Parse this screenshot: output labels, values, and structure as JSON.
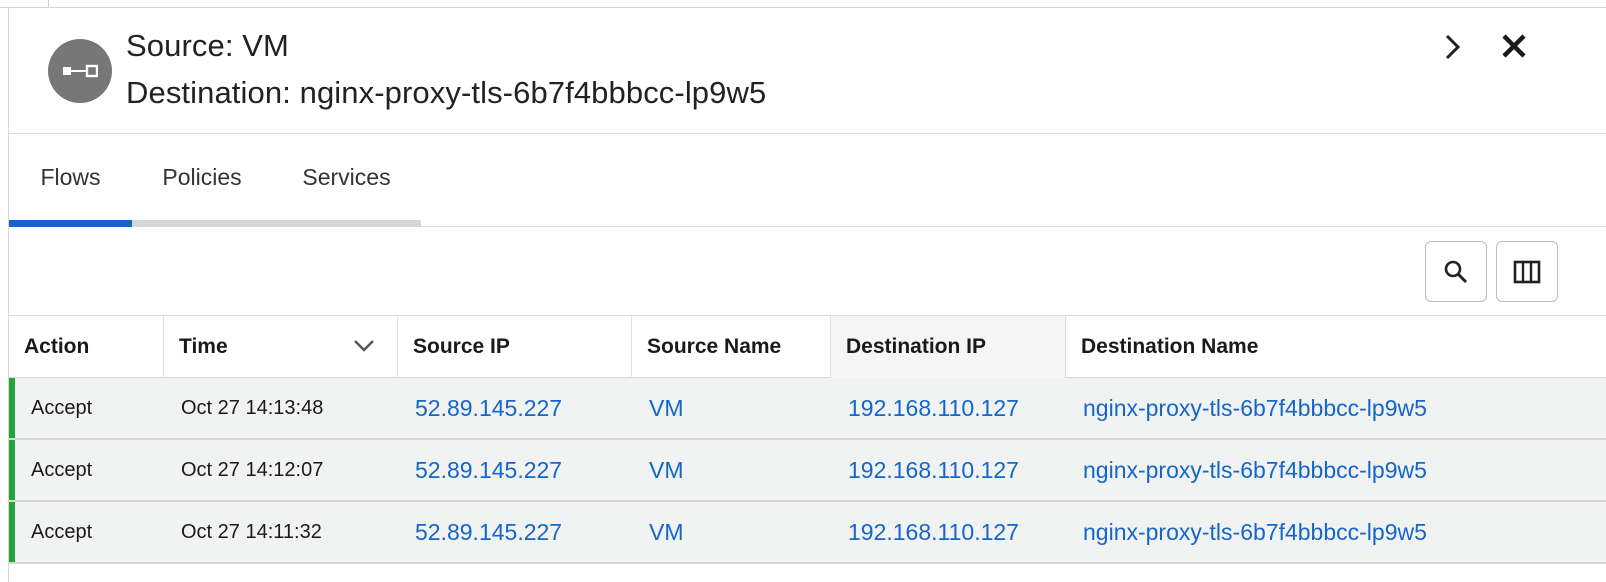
{
  "header": {
    "source_title": "Source: VM",
    "destination_title": "Destination: nginx-proxy-tls-6b7f4bbbcc-lp9w5",
    "avatar_icon": "connection-icon",
    "expand_icon": "chevron-right-icon",
    "close_icon": "close-icon"
  },
  "tabs": [
    {
      "label": "Flows",
      "active": true
    },
    {
      "label": "Policies",
      "active": false
    },
    {
      "label": "Services",
      "active": false
    }
  ],
  "toolbar": {
    "search_icon": "search-icon",
    "columns_icon": "columns-icon"
  },
  "table": {
    "columns": [
      "Action",
      "Time",
      "Source IP",
      "Source Name",
      "Destination IP",
      "Destination Name"
    ],
    "sorted_column": "Time",
    "rows": [
      {
        "action": "Accept",
        "time": "Oct 27 14:13:48",
        "source_ip": "52.89.145.227",
        "source_name": "VM",
        "destination_ip": "192.168.110.127",
        "destination_name": "nginx-proxy-tls-6b7f4bbbcc-lp9w5",
        "status_color": "#21a53a"
      },
      {
        "action": "Accept",
        "time": "Oct 27 14:12:07",
        "source_ip": "52.89.145.227",
        "source_name": "VM",
        "destination_ip": "192.168.110.127",
        "destination_name": "nginx-proxy-tls-6b7f4bbbcc-lp9w5",
        "status_color": "#21a53a"
      },
      {
        "action": "Accept",
        "time": "Oct 27 14:11:32",
        "source_ip": "52.89.145.227",
        "source_name": "VM",
        "destination_ip": "192.168.110.127",
        "destination_name": "nginx-proxy-tls-6b7f4bbbcc-lp9w5",
        "status_color": "#21a53a"
      }
    ]
  },
  "colors": {
    "accent": "#1466c9",
    "link": "#1466c9",
    "accept": "#21a53a"
  }
}
